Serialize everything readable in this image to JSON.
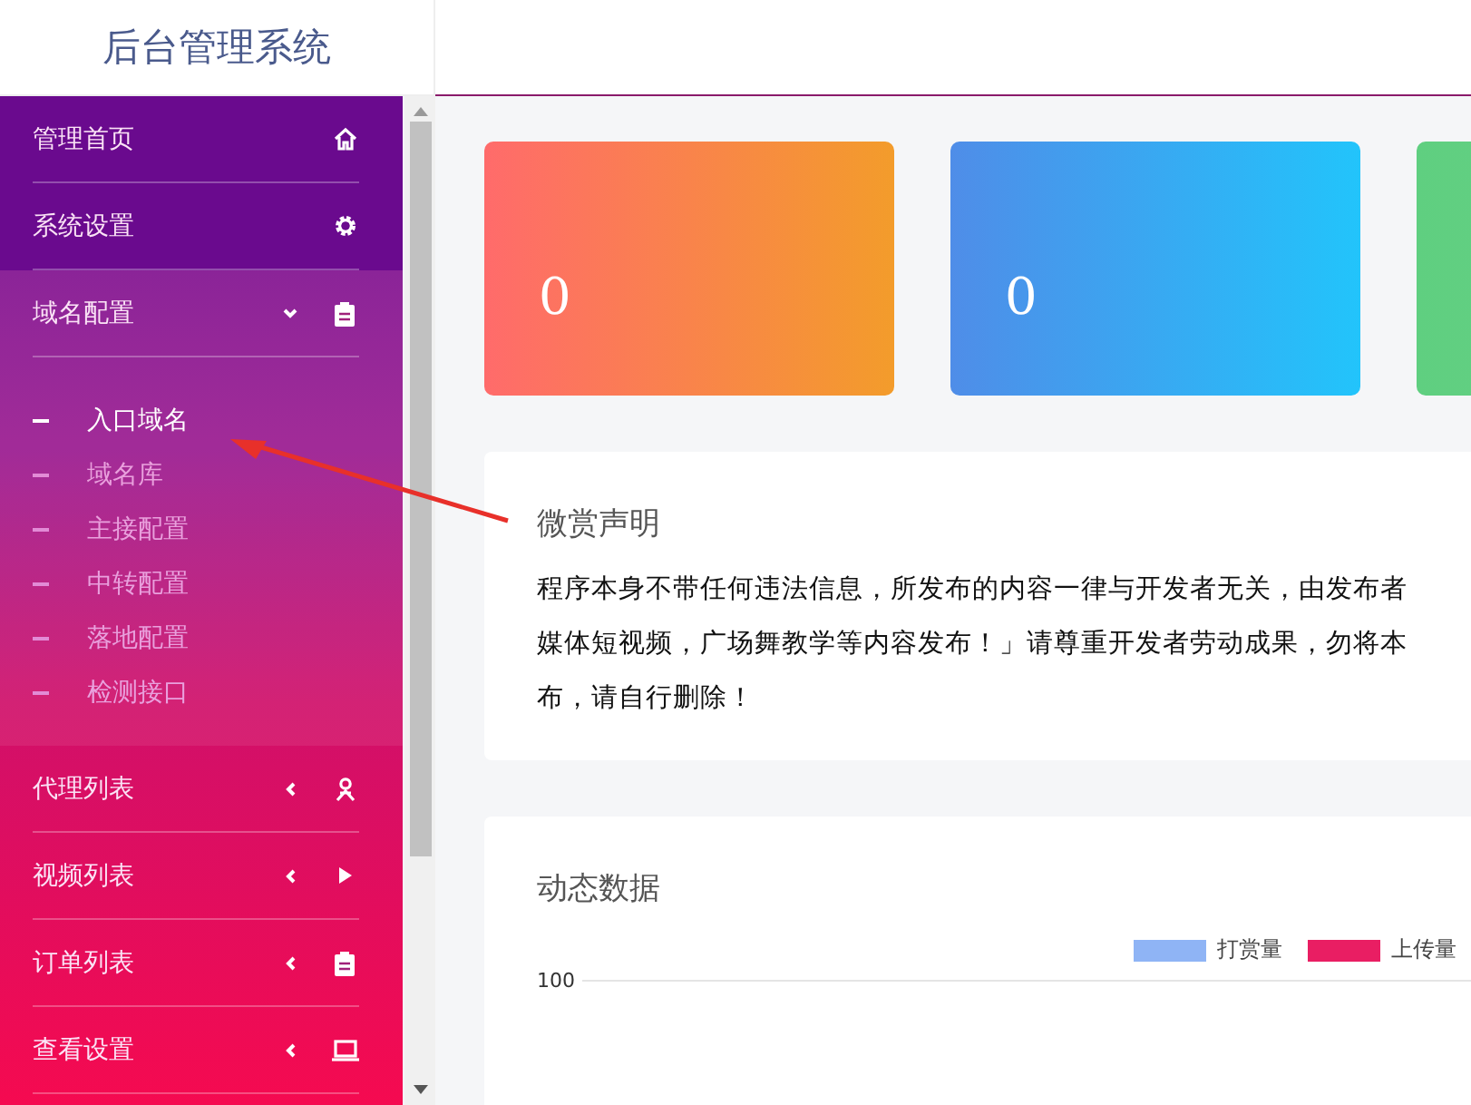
{
  "header": {
    "title": "后台管理系统"
  },
  "sidebar": {
    "items": [
      {
        "kind": "link",
        "label": "管理首页"
      },
      {
        "kind": "link",
        "label": "系统设置"
      },
      {
        "kind": "group",
        "label": "域名配置",
        "expanded": true,
        "children": [
          {
            "label": "入口域名",
            "selected": true
          },
          {
            "label": "域名库",
            "selected": false
          },
          {
            "label": "主接配置",
            "selected": false
          },
          {
            "label": "中转配置",
            "selected": false
          },
          {
            "label": "落地配置",
            "selected": false
          },
          {
            "label": "检测接口",
            "selected": false
          }
        ]
      },
      {
        "kind": "group",
        "label": "代理列表",
        "expanded": false
      },
      {
        "kind": "group",
        "label": "视频列表",
        "expanded": false
      },
      {
        "kind": "group",
        "label": "订单列表",
        "expanded": false
      },
      {
        "kind": "group",
        "label": "查看设置",
        "expanded": false
      }
    ]
  },
  "stat_cards": [
    {
      "value": "0",
      "color": "#ff6b6b"
    },
    {
      "value": "0",
      "color": "#4f8de8"
    },
    {
      "color": "#5fcf80"
    }
  ],
  "notice": {
    "title": "微赏声明",
    "lines": [
      "程序本身不带任何违法信息，所发布的内容一律与开发者无关，由发布者",
      "媒体短视频，广场舞教学等内容发布！」请尊重开发者劳动成果，勿将本",
      "布，请自行删除！"
    ]
  },
  "chart_panel": {
    "title": "动态数据",
    "legend": [
      {
        "name": "打赏量",
        "color": "#8fb4f5"
      },
      {
        "name": "上传量",
        "color": "#e91e63"
      }
    ],
    "tick": "100"
  }
}
